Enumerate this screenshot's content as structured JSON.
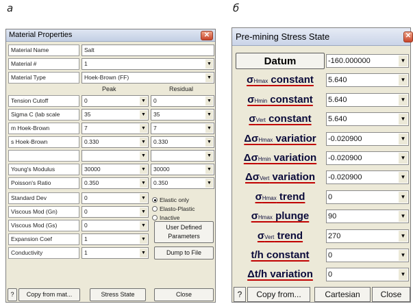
{
  "panels": {
    "a_label": "а",
    "b_label": "б"
  },
  "window_a": {
    "title": "Material Properties",
    "close_icon": "close-icon",
    "rows": {
      "material_name": {
        "label": "Material Name",
        "value": "Salt"
      },
      "material_number": {
        "label": "Material #",
        "value": "1"
      },
      "material_type": {
        "label": "Material Type",
        "value": "Hoek-Brown (FF)"
      }
    },
    "columns": {
      "peak": "Peak",
      "residual": "Residual"
    },
    "paired_rows": [
      {
        "label": "Tension Cutoff",
        "peak": "0",
        "residual": "0"
      },
      {
        "label": "Sigma C (lab scale",
        "peak": "35",
        "residual": "35"
      },
      {
        "label": "m Hoek-Brown",
        "peak": "7",
        "residual": "7"
      },
      {
        "label": "s Hoek-Brown",
        "peak": "0.330",
        "residual": "0.330"
      },
      {
        "label": "",
        "peak": "",
        "residual": ""
      },
      {
        "label": "Young's Modulus",
        "peak": "30000",
        "residual": "30000"
      },
      {
        "label": "Poisson's Ratio",
        "peak": "0.350",
        "residual": "0.350"
      }
    ],
    "single_rows": [
      {
        "label": "Standard Dev",
        "value": "0"
      },
      {
        "label": "Viscous Mod (Gn)",
        "value": "0"
      },
      {
        "label": "Viscous Mod (Gs)",
        "value": "0"
      },
      {
        "label": "Expansion Coef",
        "value": "1"
      },
      {
        "label": "Conductivity",
        "value": "1"
      }
    ],
    "radio_options": {
      "elastic": "Elastic only",
      "elasto_plastic": "Elasto-Plastic",
      "inactive": "Inactive",
      "selected": "Elastic only"
    },
    "buttons": {
      "user_defined_line1": "User Defined",
      "user_defined_line2": "Parameters",
      "dump": "Dump to File",
      "help": "?",
      "copy": "Copy from mat...",
      "stress_state": "Stress State",
      "close": "Close"
    }
  },
  "window_b": {
    "title": "Pre-mining Stress State",
    "close_icon": "close-icon",
    "rows": [
      {
        "prefix": "",
        "sub": "",
        "suffix": "Datum",
        "value": "-160.000000"
      },
      {
        "prefix": "σ",
        "sub": "Hmax",
        "suffix": " constant",
        "value": "5.640"
      },
      {
        "prefix": "σ",
        "sub": "Hmin",
        "suffix": " constant",
        "value": "5.640"
      },
      {
        "prefix": "σ",
        "sub": "Vert",
        "suffix": " constant",
        "value": "5.640"
      },
      {
        "prefix": "Δσ",
        "sub": "Hmax",
        "suffix": " variatior",
        "value": "-0.020900"
      },
      {
        "prefix": "Δσ",
        "sub": "Hmin",
        "suffix": " variation",
        "value": "-0.020900"
      },
      {
        "prefix": "Δσ",
        "sub": "Vert",
        "suffix": " variation",
        "value": "-0.020900"
      },
      {
        "prefix": "σ",
        "sub": "Hmax",
        "suffix": " trend",
        "value": "0"
      },
      {
        "prefix": "σ",
        "sub": "Hmax",
        "suffix": " plunge",
        "value": "90"
      },
      {
        "prefix": "σ",
        "sub": "Vert",
        "suffix": " trend",
        "value": "270"
      },
      {
        "prefix": "",
        "sub": "",
        "suffix": "t/h constant",
        "value": "0"
      },
      {
        "prefix": "",
        "sub": "",
        "suffix": "Δt/h variation",
        "value": "0"
      }
    ],
    "buttons": {
      "help": "?",
      "copy": "Copy from...",
      "cartesian": "Cartesian",
      "close": "Close"
    }
  }
}
